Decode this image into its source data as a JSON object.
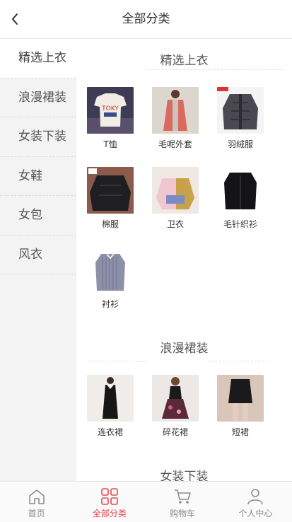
{
  "header": {
    "title": "全部分类"
  },
  "sidebar": {
    "items": [
      {
        "label": "精选上衣"
      },
      {
        "label": "浪漫裙装"
      },
      {
        "label": "女装下装"
      },
      {
        "label": "女鞋"
      },
      {
        "label": "女包"
      },
      {
        "label": "风衣"
      }
    ]
  },
  "sections": [
    {
      "title": "精选上衣",
      "products": [
        {
          "name": "T恤"
        },
        {
          "name": "毛呢外套"
        },
        {
          "name": "羽绒服"
        },
        {
          "name": "棉服"
        },
        {
          "name": "卫衣"
        },
        {
          "name": "毛针织衫"
        },
        {
          "name": "衬衫"
        }
      ]
    },
    {
      "title": "浪漫裙装",
      "products": [
        {
          "name": "连衣裙"
        },
        {
          "name": "碎花裙"
        },
        {
          "name": "短裙"
        }
      ]
    },
    {
      "title": "女装下装"
    }
  ],
  "tabbar": {
    "items": [
      {
        "label": "首页",
        "icon": "home-icon"
      },
      {
        "label": "全部分类",
        "icon": "grid-icon"
      },
      {
        "label": "购物车",
        "icon": "cart-icon"
      },
      {
        "label": "个人中心",
        "icon": "user-icon"
      }
    ]
  },
  "colors": {
    "accent": "#e8474f",
    "sidebar_bg": "#f3f3f3",
    "text": "#333333"
  }
}
